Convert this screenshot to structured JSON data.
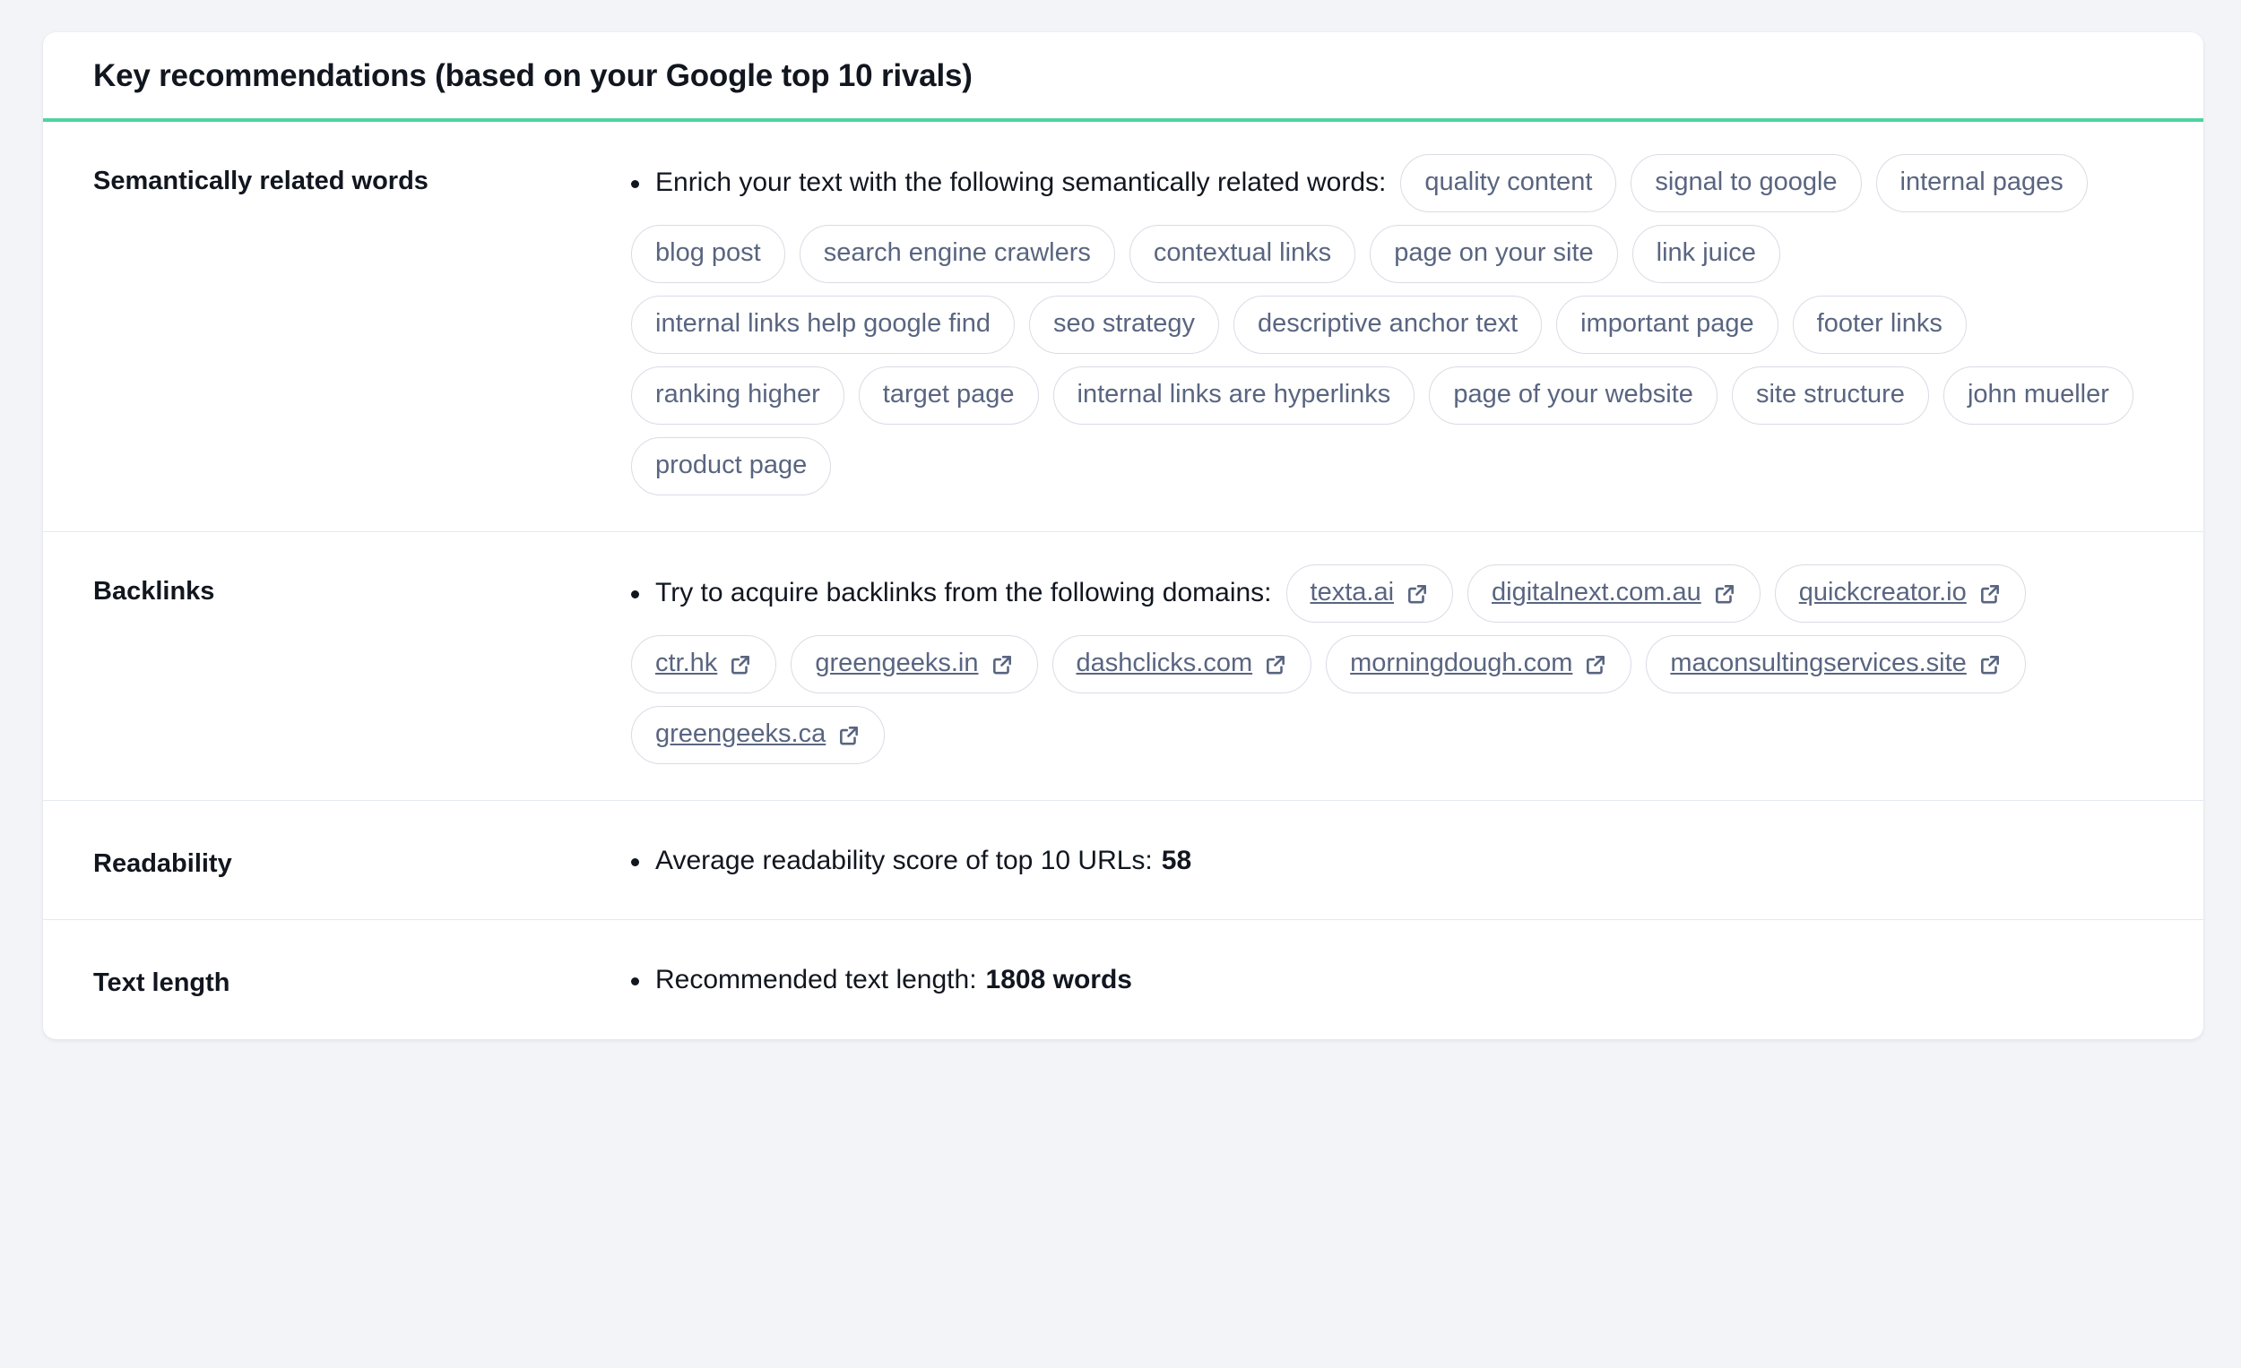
{
  "card": {
    "title": "Key recommendations (based on your Google top 10 rivals)",
    "accent_color": "#4fd3a1",
    "background_color": "#f3f4f8",
    "chip_text_color": "#596580",
    "chip_border_color": "#d9dce5"
  },
  "sections": {
    "semantic": {
      "label": "Semantically related words",
      "intro": "Enrich your text with the following semantically related words:",
      "tags": [
        "quality content",
        "signal to google",
        "internal pages",
        "blog post",
        "search engine crawlers",
        "contextual links",
        "page on your site",
        "link juice",
        "internal links help google find",
        "seo strategy",
        "descriptive anchor text",
        "important page",
        "footer links",
        "ranking higher",
        "target page",
        "internal links are hyperlinks",
        "page of your website",
        "site structure",
        "john mueller",
        "product page"
      ]
    },
    "backlinks": {
      "label": "Backlinks",
      "intro": "Try to acquire backlinks from the following domains:",
      "icon": "external-link-icon",
      "domains": [
        "texta.ai",
        "digitalnext.com.au",
        "quickcreator.io",
        "ctr.hk",
        "greengeeks.in",
        "dashclicks.com",
        "morningdough.com",
        "maconsultingservices.site",
        "greengeeks.ca"
      ]
    },
    "readability": {
      "label": "Readability",
      "text": "Average readability score of top 10 URLs:",
      "value": "58"
    },
    "text_length": {
      "label": "Text length",
      "text": "Recommended text length:",
      "value": "1808 words"
    }
  }
}
